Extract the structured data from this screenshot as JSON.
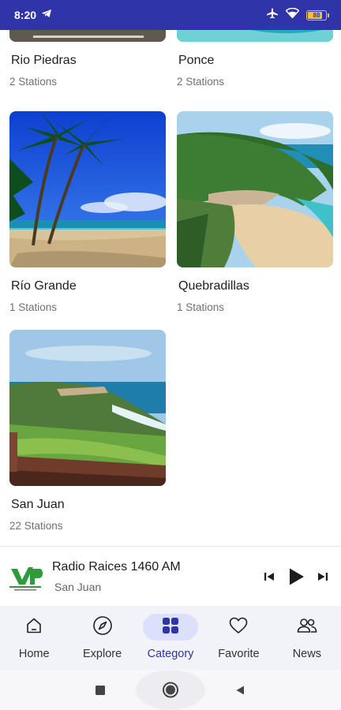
{
  "status_bar": {
    "time": "8:20",
    "battery": "88"
  },
  "cities": [
    {
      "name": "Rio Piedras",
      "stations": "2 Stations"
    },
    {
      "name": "Ponce",
      "stations": "2 Stations"
    },
    {
      "name": "Río Grande",
      "stations": "1 Stations"
    },
    {
      "name": "Quebradillas",
      "stations": "1 Stations"
    },
    {
      "name": "San Juan",
      "stations": "22 Stations"
    }
  ],
  "player": {
    "station": "Radio Raices 1460 AM",
    "city": "San Juan"
  },
  "nav": {
    "items": [
      {
        "label": "Home"
      },
      {
        "label": "Explore"
      },
      {
        "label": "Category"
      },
      {
        "label": "Favorite"
      },
      {
        "label": "News"
      }
    ],
    "active": "Category"
  },
  "colors": {
    "primary": "#2f35a8",
    "active_pill": "#dde0fa",
    "nav_bg": "#f2f2f9"
  }
}
